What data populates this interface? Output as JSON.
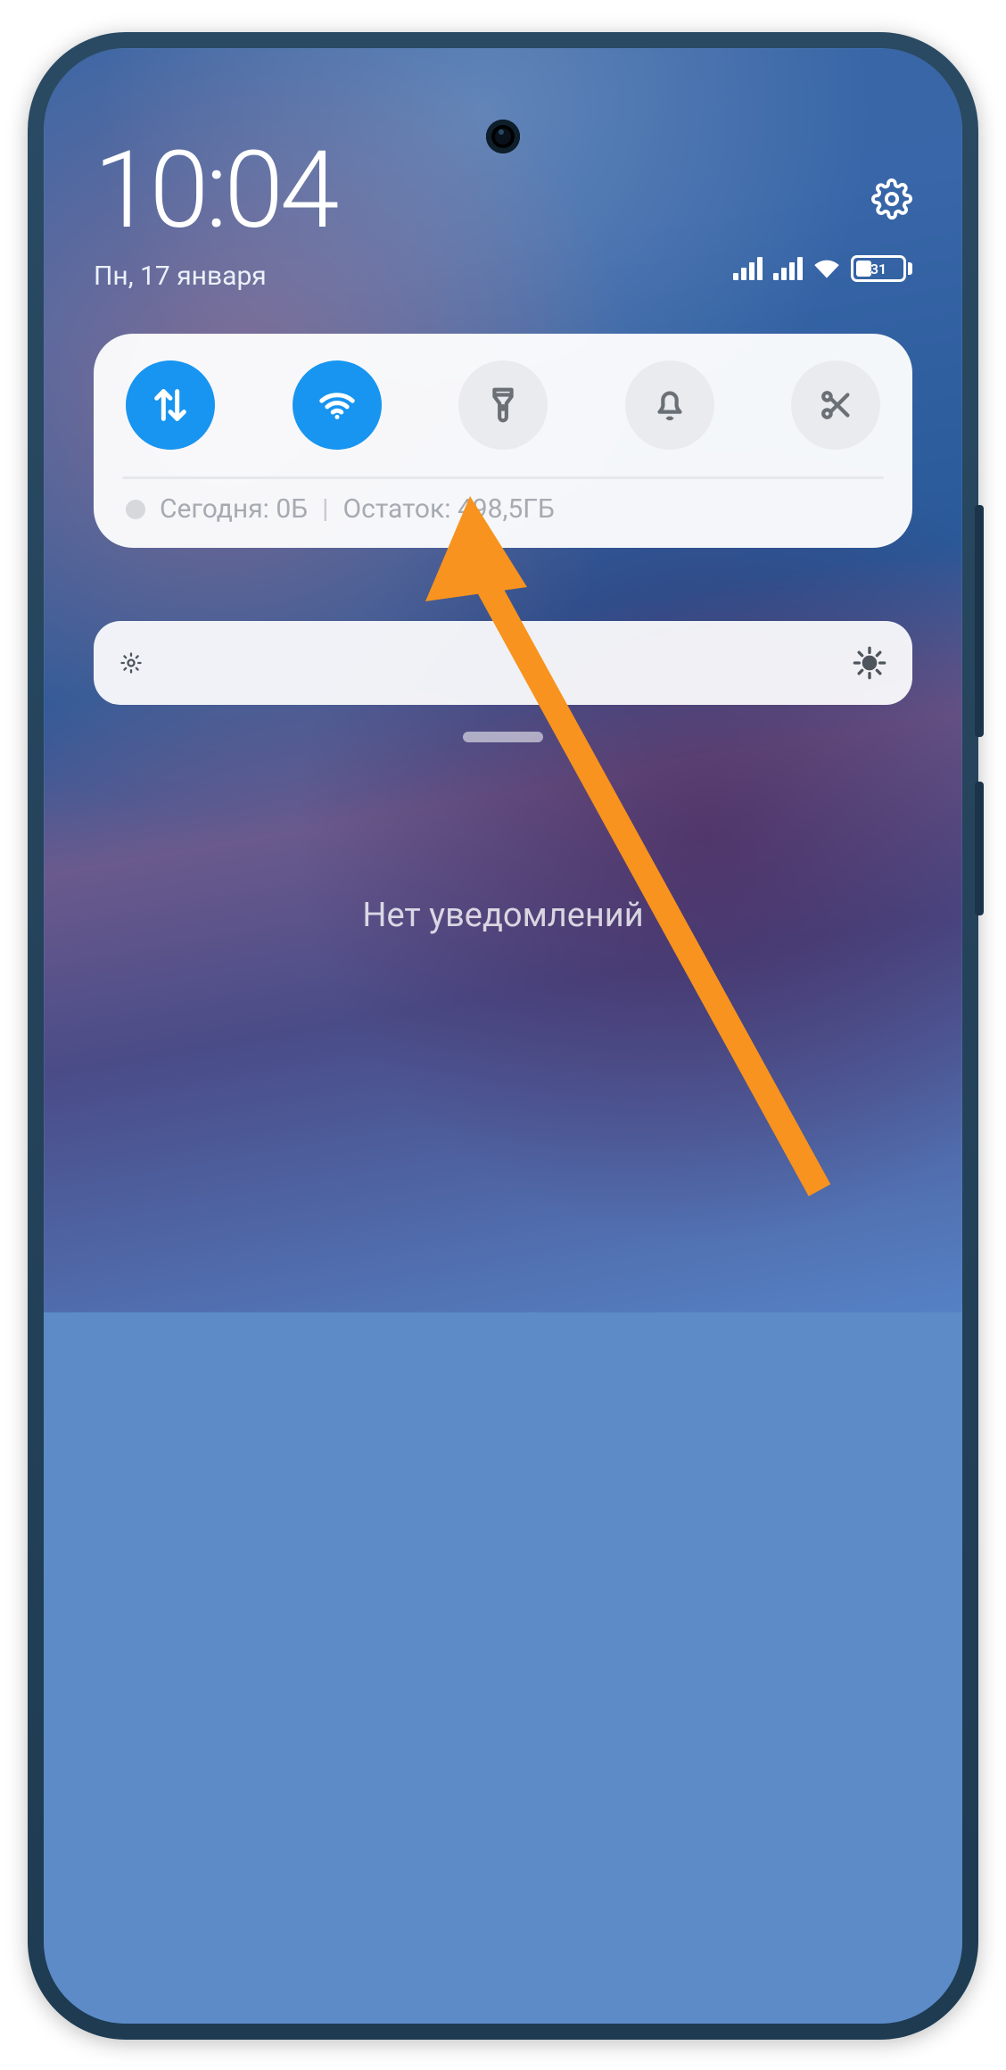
{
  "header": {
    "time": "10:04",
    "date": "Пн, 17 января",
    "battery_percent": "31"
  },
  "quick_settings": {
    "toggles": [
      {
        "id": "mobile-data",
        "active": true
      },
      {
        "id": "wifi",
        "active": true
      },
      {
        "id": "flashlight",
        "active": false
      },
      {
        "id": "sound",
        "active": false
      },
      {
        "id": "screenshot",
        "active": false
      }
    ],
    "usage_today_label": "Сегодня: 0Б",
    "usage_separator": "|",
    "usage_remaining_label": "Остаток: 498,5ГБ"
  },
  "notifications": {
    "empty_text": "Нет уведомлений"
  },
  "annotation": {
    "color": "#f7931e"
  }
}
